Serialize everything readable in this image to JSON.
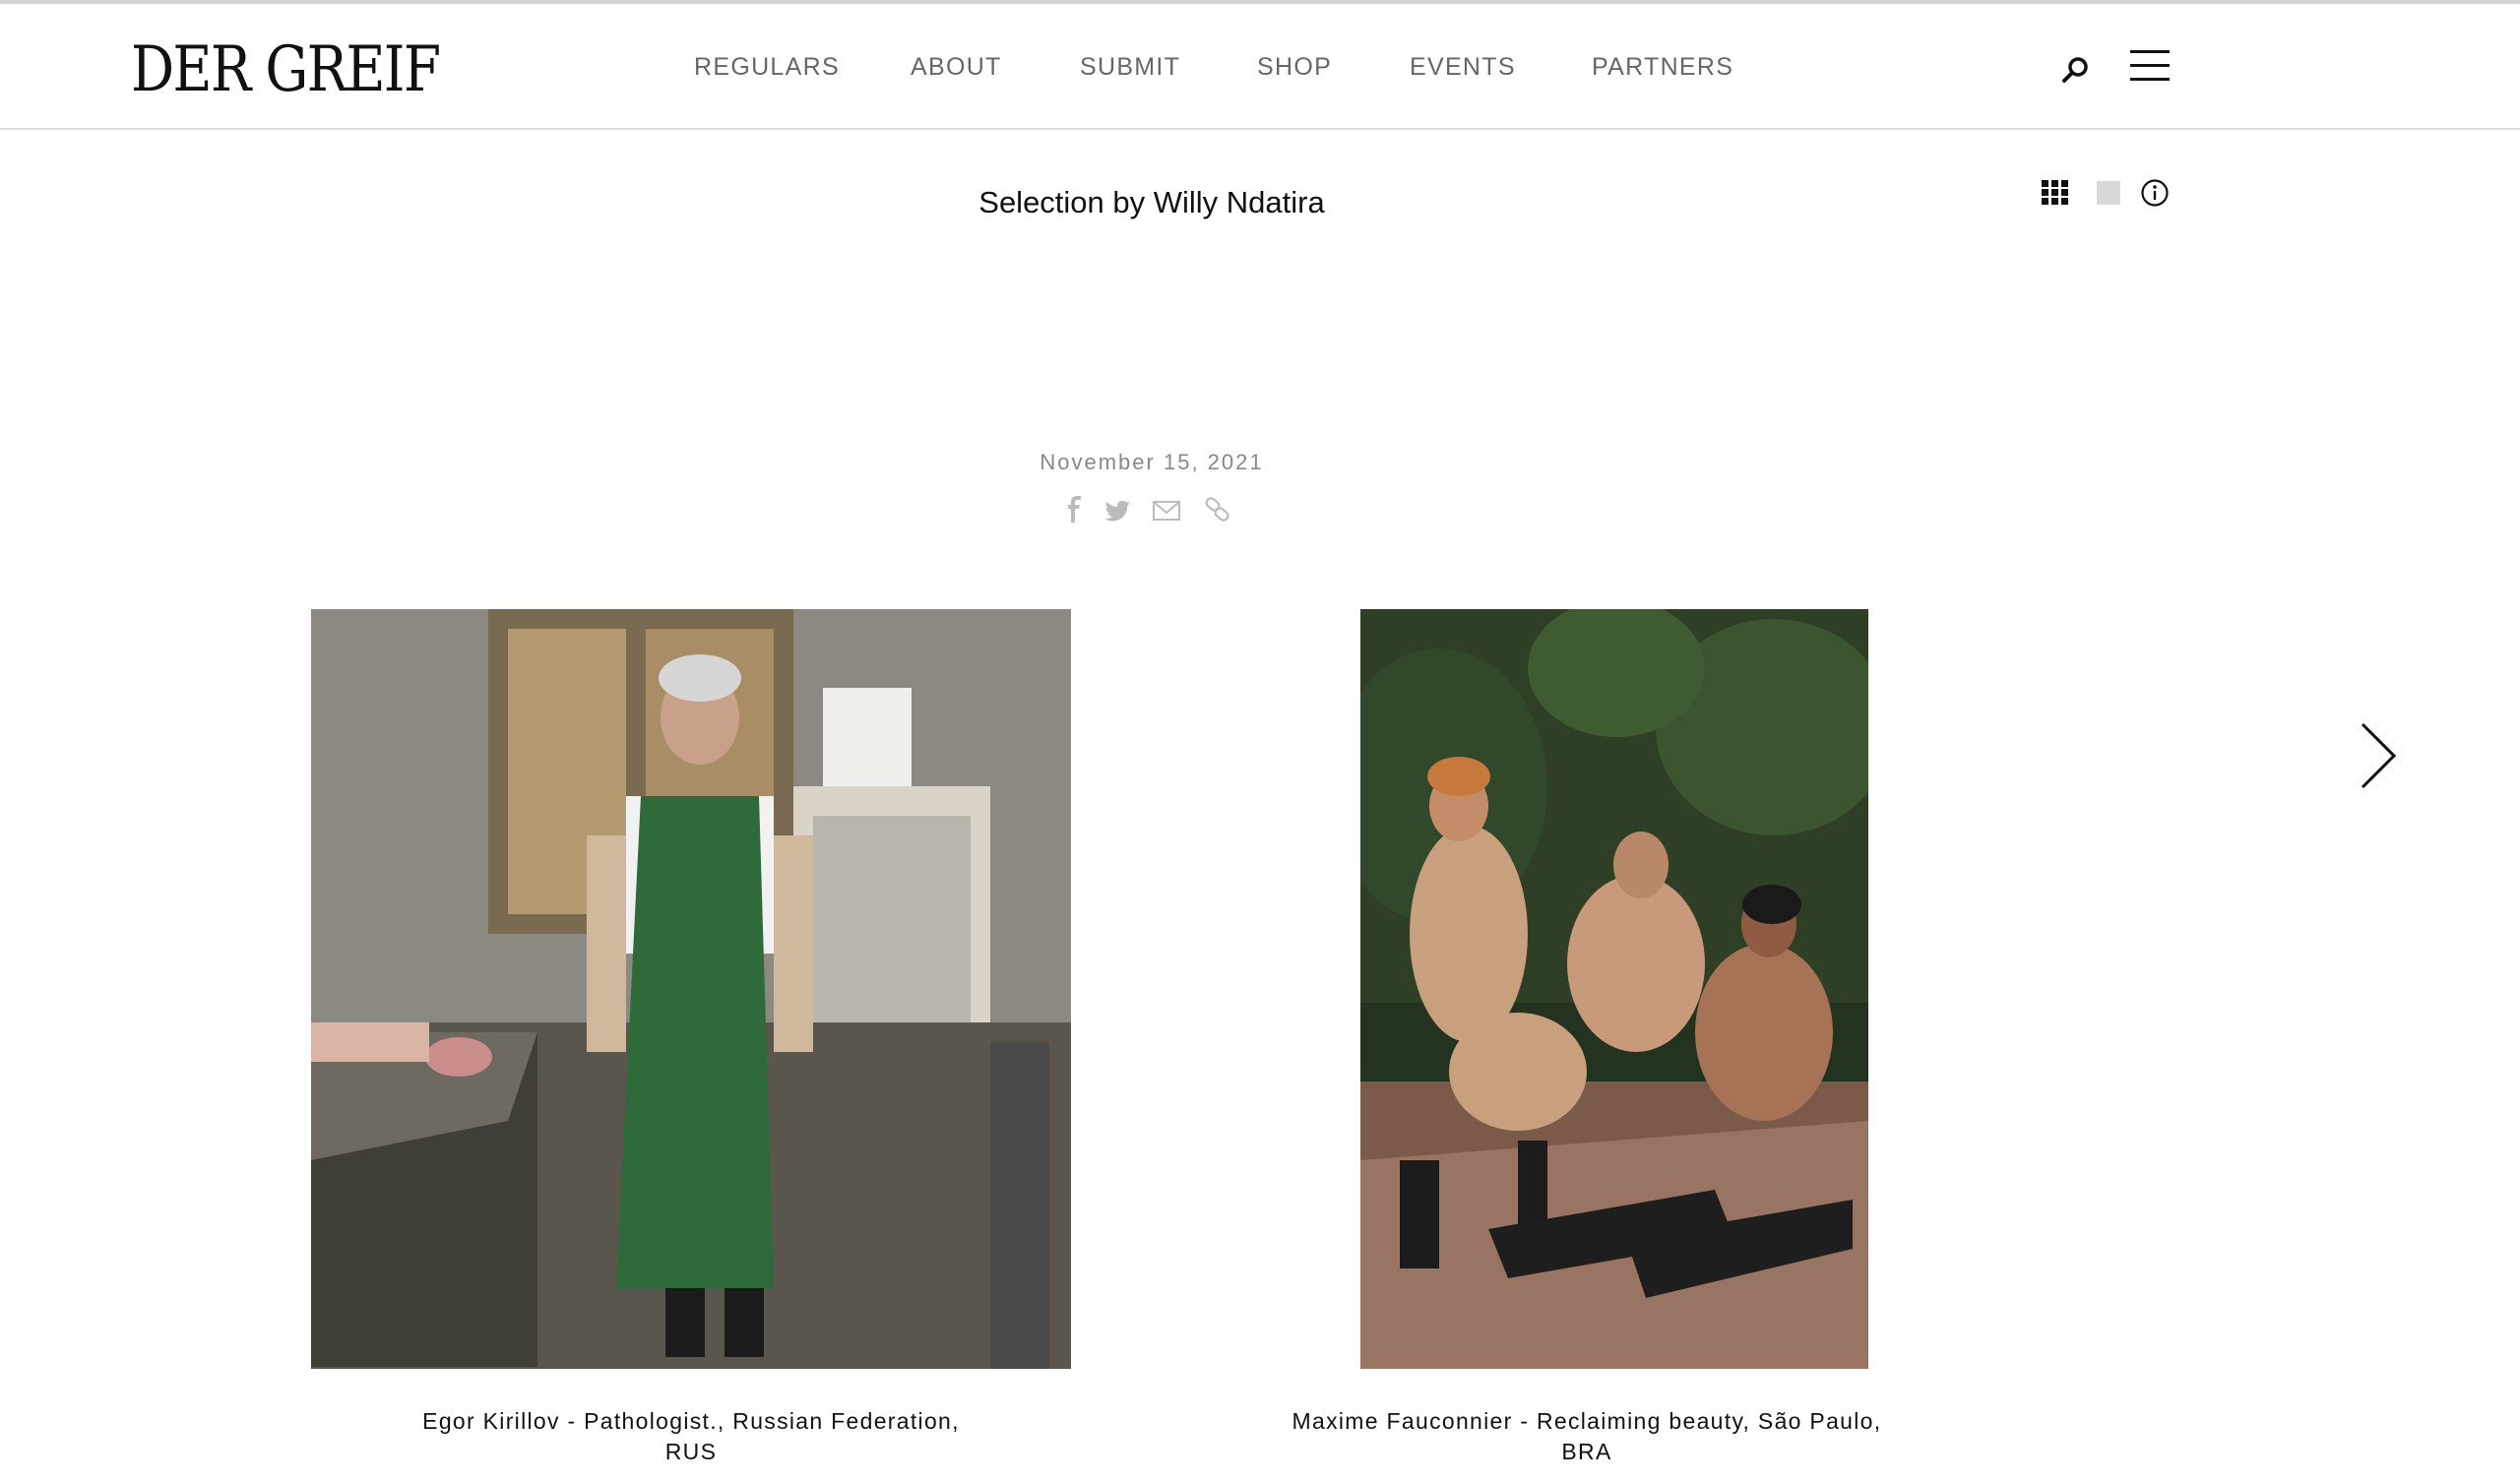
{
  "site": {
    "logo_text": "DER GREIF"
  },
  "nav": {
    "items": [
      {
        "label": "REGULARS"
      },
      {
        "label": "ABOUT"
      },
      {
        "label": "SUBMIT"
      },
      {
        "label": "SHOP"
      },
      {
        "label": "EVENTS"
      },
      {
        "label": "PARTNERS"
      }
    ],
    "search_icon": "search-icon",
    "menu_icon": "hamburger-menu-icon"
  },
  "page": {
    "title": "Selection by Willy Ndatira",
    "view_tools": [
      "grid-view-icon",
      "single-view-icon",
      "info-icon"
    ]
  },
  "post": {
    "date": "November 15, 2021",
    "share_icons": [
      "facebook-icon",
      "twitter-icon",
      "email-icon",
      "link-icon"
    ]
  },
  "gallery": {
    "items": [
      {
        "caption_line1": "Egor Kirillov - Pathologist., Russian Federation,",
        "caption_line2": "RUS"
      },
      {
        "caption_line1": "Maxime Fauconnier - Reclaiming beauty, São Paulo,",
        "caption_line2": "BRA"
      }
    ],
    "next_icon": "chevron-right-icon"
  },
  "colors": {
    "nav_text": "#666666",
    "date_text": "#888888",
    "icon_gray": "#bbbbbb"
  }
}
